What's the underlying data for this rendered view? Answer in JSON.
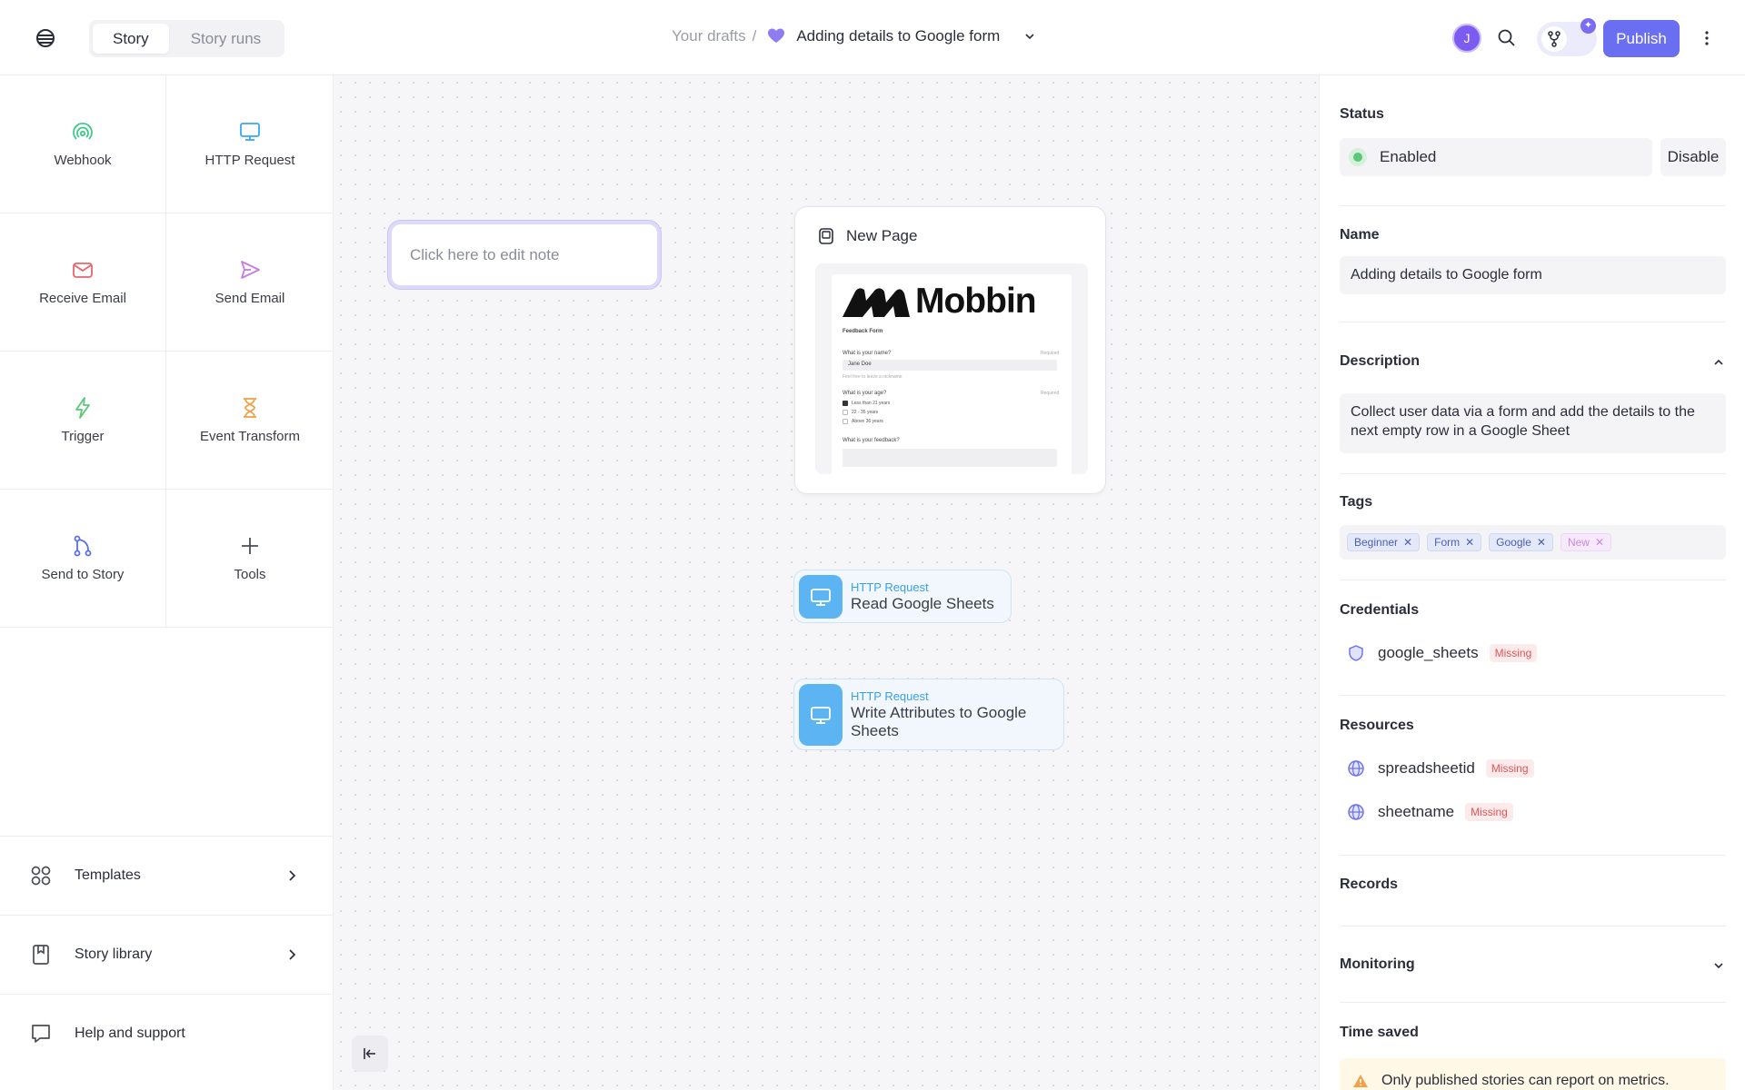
{
  "header": {
    "tabs": [
      {
        "label": "Story",
        "active": true
      },
      {
        "label": "Story runs",
        "active": false
      }
    ],
    "breadcrumb_root": "Your drafts",
    "breadcrumb_sep": "/",
    "story_title": "Adding details to Google form",
    "avatar_initial": "J",
    "publish_label": "Publish"
  },
  "tools": [
    {
      "label": "Webhook",
      "icon": "webhook-icon",
      "color": "#3ec98a"
    },
    {
      "label": "HTTP Request",
      "icon": "monitor-icon",
      "color": "#3aa7ee"
    },
    {
      "label": "Receive Email",
      "icon": "mail-icon",
      "color": "#e8666d"
    },
    {
      "label": "Send Email",
      "icon": "send-icon",
      "color": "#c77be6"
    },
    {
      "label": "Trigger",
      "icon": "bolt-icon",
      "color": "#5cc679"
    },
    {
      "label": "Event Transform",
      "icon": "hourglass-icon",
      "color": "#f0a24a"
    },
    {
      "label": "Send to Story",
      "icon": "branch-icon",
      "color": "#5b6ee0"
    },
    {
      "label": "Tools",
      "icon": "plus-icon",
      "color": "#4a4c58"
    }
  ],
  "left_nav": [
    {
      "label": "Templates",
      "icon": "grid-icon",
      "chevron": true
    },
    {
      "label": "Story library",
      "icon": "book-icon",
      "chevron": true
    },
    {
      "label": "Help and support",
      "icon": "support-icon",
      "chevron": false
    }
  ],
  "canvas": {
    "note_placeholder": "Click here to edit note",
    "page_card": {
      "title": "New Page",
      "preview": {
        "brand": "Mobbin",
        "form_title": "Feedback Form",
        "q1": "What is your name?",
        "q1_required": "Required",
        "q1_value": "Jane Doe",
        "q1_hint": "Feel free to leave a nickname",
        "q2": "What is your age?",
        "q2_required": "Required",
        "q2_options": [
          "Less than 21 years",
          "22 - 35 years",
          "Above 36 years"
        ],
        "q3": "What is your feedback?"
      }
    },
    "actions": [
      {
        "kind": "HTTP Request",
        "title": "Read Google Sheets"
      },
      {
        "kind": "HTTP Request",
        "title": "Write Attributes to Google Sheets"
      }
    ]
  },
  "panel": {
    "status_label": "Status",
    "status_value": "Enabled",
    "disable_label": "Disable",
    "name_label": "Name",
    "name_value": "Adding details to Google form",
    "description_label": "Description",
    "description_value": "Collect user data via a form and add the details to the next empty row in a Google Sheet",
    "tags_label": "Tags",
    "tags": [
      {
        "label": "Beginner",
        "style": "blue"
      },
      {
        "label": "Form",
        "style": "blue"
      },
      {
        "label": "Google",
        "style": "blue"
      },
      {
        "label": "New",
        "style": "pink"
      }
    ],
    "credentials_label": "Credentials",
    "credentials": [
      {
        "name": "google_sheets",
        "badge": "Missing"
      }
    ],
    "resources_label": "Resources",
    "resources": [
      {
        "name": "spreadsheetid",
        "badge": "Missing"
      },
      {
        "name": "sheetname",
        "badge": "Missing"
      }
    ],
    "records_label": "Records",
    "monitoring_label": "Monitoring",
    "time_saved_label": "Time saved",
    "warning_text": "Only published stories can report on metrics."
  },
  "colors": {
    "accent": "#6a6ef0",
    "action_icon_bg": "#5db4f3",
    "missing_badge": "#e05656",
    "enabled_dot": "#5cc679"
  }
}
